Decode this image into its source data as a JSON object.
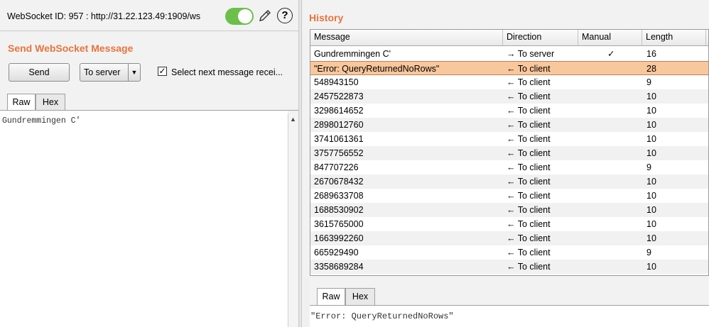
{
  "websocket": {
    "id_text": "WebSocket ID: 957 : http://31.22.123.49:1909/ws"
  },
  "icons": {
    "toggle": "toggle-on-icon",
    "pencil": "pencil-icon",
    "help": "help-icon",
    "help_glyph": "?"
  },
  "send": {
    "title": "Send WebSocket Message",
    "send_label": "Send",
    "direction_value": "To server",
    "checkbox_label": "Select next message recei..."
  },
  "left_tabs": [
    "Raw",
    "Hex"
  ],
  "editor": {
    "content": "Gundremmingen C'"
  },
  "history": {
    "title": "History",
    "columns": [
      "Message",
      "Direction",
      "Manual",
      "Length"
    ],
    "rows": [
      {
        "message": "Gundremmingen C'",
        "direction": "→ To server",
        "manual": "✓",
        "length": "16"
      },
      {
        "message": "\"Error: QueryReturnedNoRows\"",
        "direction": "← To client",
        "manual": "",
        "length": "28"
      },
      {
        "message": "548943150",
        "direction": "← To client",
        "manual": "",
        "length": "9"
      },
      {
        "message": "2457522873",
        "direction": "← To client",
        "manual": "",
        "length": "10"
      },
      {
        "message": "3298614652",
        "direction": "← To client",
        "manual": "",
        "length": "10"
      },
      {
        "message": "2898012760",
        "direction": "← To client",
        "manual": "",
        "length": "10"
      },
      {
        "message": "3741061361",
        "direction": "← To client",
        "manual": "",
        "length": "10"
      },
      {
        "message": "3757756552",
        "direction": "← To client",
        "manual": "",
        "length": "10"
      },
      {
        "message": "847707226",
        "direction": "← To client",
        "manual": "",
        "length": "9"
      },
      {
        "message": "2670678432",
        "direction": "← To client",
        "manual": "",
        "length": "10"
      },
      {
        "message": "2689633708",
        "direction": "← To client",
        "manual": "",
        "length": "10"
      },
      {
        "message": "1688530902",
        "direction": "← To client",
        "manual": "",
        "length": "10"
      },
      {
        "message": "3615765000",
        "direction": "← To client",
        "manual": "",
        "length": "10"
      },
      {
        "message": "1663992260",
        "direction": "← To client",
        "manual": "",
        "length": "10"
      },
      {
        "message": "665929490",
        "direction": "← To client",
        "manual": "",
        "length": "9"
      },
      {
        "message": "3358689284",
        "direction": "← To client",
        "manual": "",
        "length": "10"
      }
    ],
    "selected_index": 1
  },
  "right_tabs": [
    "Raw",
    "Hex"
  ],
  "detail": {
    "content": "\"Error: QueryReturnedNoRows\""
  },
  "colors": {
    "accent": "#e8743b",
    "selected_row": "#f9c79c",
    "toggle_on": "#6cc04a"
  }
}
